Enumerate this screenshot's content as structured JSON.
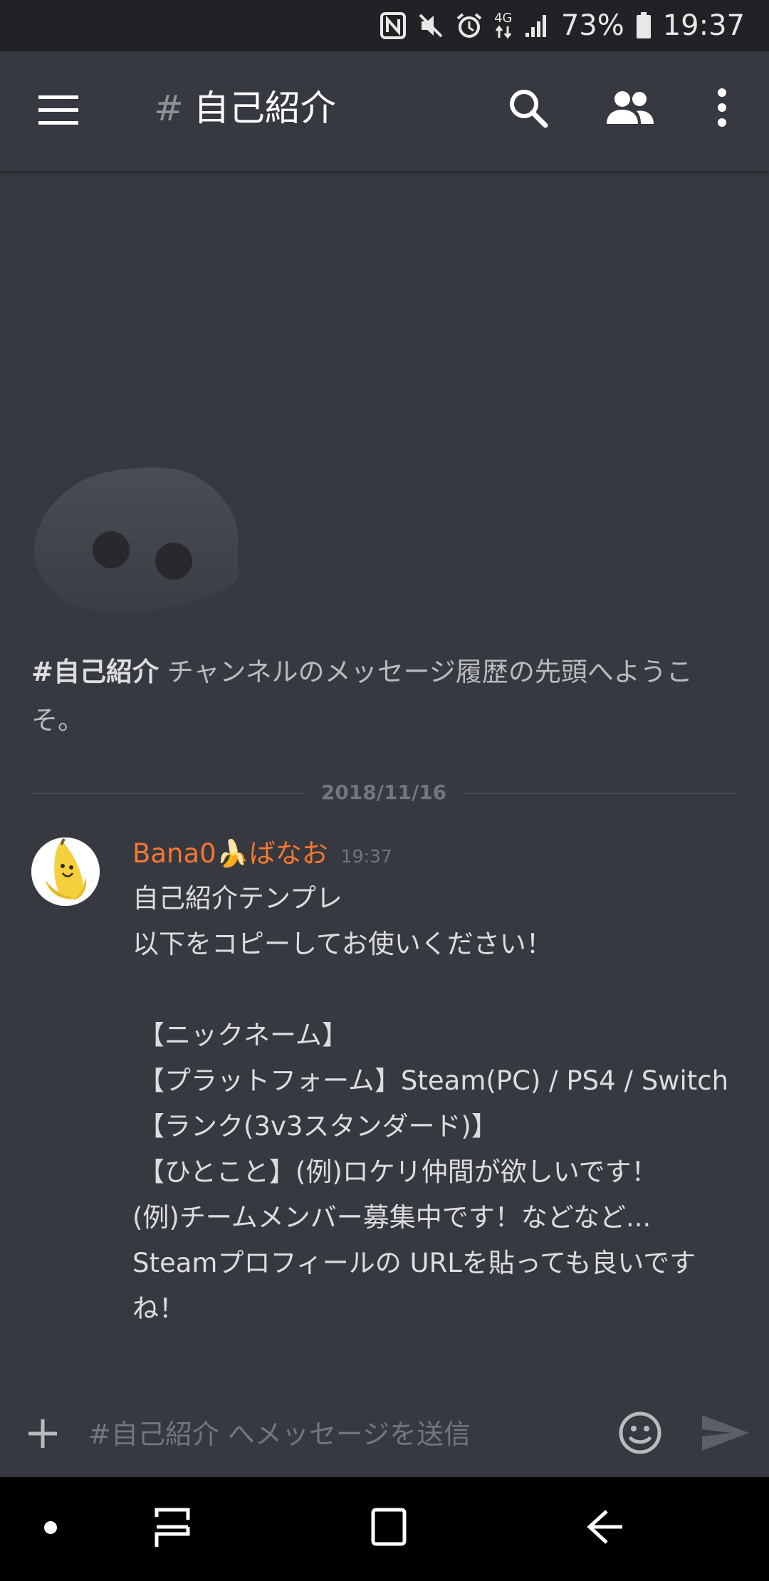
{
  "status_bar": {
    "battery_text": "73%",
    "network_type": "4G",
    "time": "19:37",
    "icons": [
      "nfc-icon",
      "mute-icon",
      "alarm-icon",
      "data-arrows-icon",
      "signal-icon",
      "battery-icon"
    ]
  },
  "app_bar": {
    "hash": "#",
    "channel_name": "自己紹介",
    "icons": [
      "menu-icon",
      "search-icon",
      "members-icon",
      "more-vertical-icon"
    ]
  },
  "welcome": {
    "channel_bold": "#自己紹介",
    "text": " チャンネルのメッセージ履歴の先頭へようこそ。"
  },
  "divider": {
    "date": "2018/11/16"
  },
  "message": {
    "author": "Bana0🍌ばなお",
    "timestamp": "19:37",
    "lines": [
      "自己紹介テンプレ",
      "以下をコピーしてお使いください！",
      "",
      "【ニックネーム】",
      "【プラットフォーム】Steam(PC) / PS4 / Switch",
      "【ランク(3v3スタンダード)】",
      "【ひとこと】(例)ロケリ仲間が欲しいです！",
      "(例)チームメンバー募集中です！などなど...",
      "Steamプロフィールの URLを貼っても良いです",
      "ね！"
    ]
  },
  "composer": {
    "placeholder": "#自己紹介 へメッセージを送信",
    "icons": [
      "plus-icon",
      "emoji-icon",
      "send-icon"
    ]
  },
  "nav_bar": {
    "icons": [
      "dot-icon",
      "recents-icon",
      "home-icon",
      "back-icon"
    ]
  },
  "colors": {
    "background": "#36393f",
    "status_bar": "#202225",
    "author": "#f57731",
    "muted": "#72767d"
  }
}
